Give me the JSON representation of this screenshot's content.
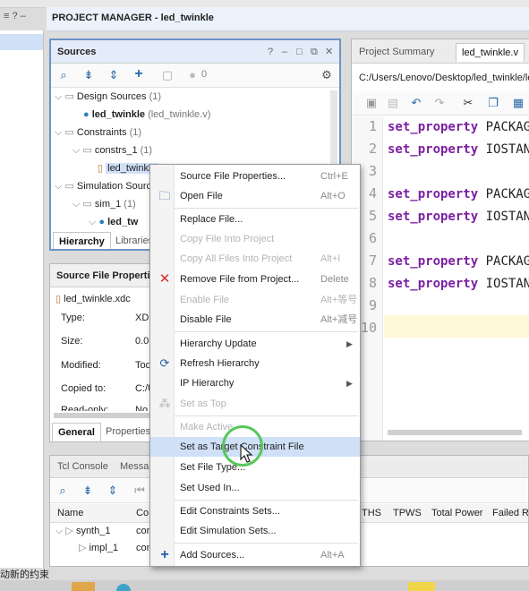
{
  "titlebar": {
    "title": "PROJECT MANAGER - led_twinkle",
    "left_glyphs": "≡ ? –"
  },
  "sources": {
    "title": "Sources",
    "controls": [
      "?",
      "–",
      "□",
      "⧉",
      "✕"
    ],
    "badge_count": "0",
    "tree": [
      {
        "text": "Design Sources",
        "count": "(1)"
      },
      {
        "text": "led_twinkle",
        "extra": "(led_twinkle.v)"
      },
      {
        "text": "Constraints",
        "count": "(1)"
      },
      {
        "text": "constrs_1",
        "count": "(1)"
      },
      {
        "text": "led_twinkle",
        "extra": ""
      },
      {
        "text": "Simulation Sources",
        "count": ""
      },
      {
        "text": "sim_1",
        "count": "(1)"
      },
      {
        "text": "led_tw",
        "extra": ""
      }
    ],
    "tabs": [
      "Hierarchy",
      "Libraries"
    ]
  },
  "properties": {
    "title": "Source File Properties",
    "file": "led_twinkle.xdc",
    "rows": [
      {
        "label": "Type:",
        "value": "XD"
      },
      {
        "label": "Size:",
        "value": "0.0"
      },
      {
        "label": "Modified:",
        "value": "Tod"
      },
      {
        "label": "Copied to:",
        "value": "C:/U"
      },
      {
        "label": "Read-only:",
        "value": "No"
      }
    ],
    "tabs": [
      "General",
      "Properties"
    ]
  },
  "bottom": {
    "tabs": [
      "Tcl Console",
      "Messa"
    ],
    "columns": [
      "Name",
      "Co",
      "THS",
      "TPWS",
      "Total Power",
      "Failed Ro"
    ],
    "rows": [
      {
        "name": "synth_1",
        "c": "con"
      },
      {
        "name": "impl_1",
        "c": "con"
      }
    ]
  },
  "editor": {
    "tabs": [
      "Project Summary",
      "led_twinkle.v"
    ],
    "path": "C:/Users/Lenovo/Desktop/led_twinkle/led_",
    "lines": [
      {
        "n": "1",
        "kw": "set_property",
        "rest": " PACKAGE"
      },
      {
        "n": "2",
        "kw": "set_property",
        "rest": " IOSTAND"
      },
      {
        "n": "3",
        "kw": "",
        "rest": ""
      },
      {
        "n": "4",
        "kw": "set_property",
        "rest": " PACKAGE"
      },
      {
        "n": "5",
        "kw": "set_property",
        "rest": " IOSTAND"
      },
      {
        "n": "6",
        "kw": "",
        "rest": ""
      },
      {
        "n": "7",
        "kw": "set_property",
        "rest": " PACKAGE"
      },
      {
        "n": "8",
        "kw": "set_property",
        "rest": " IOSTAND"
      },
      {
        "n": "9",
        "kw": "",
        "rest": ""
      },
      {
        "n": "10",
        "kw": "",
        "rest": ""
      }
    ]
  },
  "context_menu": {
    "items": [
      {
        "label": "Source File Properties...",
        "shortcut": "Ctrl+E",
        "icon": "",
        "disabled": false
      },
      {
        "label": "Open File",
        "shortcut": "Alt+O",
        "icon": "folder-icon",
        "disabled": false
      },
      {
        "label": "Replace File...",
        "shortcut": "",
        "icon": "",
        "disabled": false
      },
      {
        "label": "Copy File Into Project",
        "shortcut": "",
        "icon": "",
        "disabled": true
      },
      {
        "label": "Copy All Files Into Project",
        "shortcut": "Alt+I",
        "icon": "",
        "disabled": true
      },
      {
        "label": "Remove File from Project...",
        "shortcut": "Delete",
        "icon": "remove-x-icon",
        "disabled": false
      },
      {
        "label": "Enable File",
        "shortcut": "Alt+等号",
        "icon": "",
        "disabled": true
      },
      {
        "label": "Disable File",
        "shortcut": "Alt+减号",
        "icon": "",
        "disabled": false
      },
      {
        "label": "Hierarchy Update",
        "shortcut": "",
        "icon": "",
        "disabled": false,
        "submenu": true
      },
      {
        "label": "Refresh Hierarchy",
        "shortcut": "",
        "icon": "refresh-icon",
        "disabled": false
      },
      {
        "label": "IP Hierarchy",
        "shortcut": "",
        "icon": "",
        "disabled": false,
        "submenu": true
      },
      {
        "label": "Set as Top",
        "shortcut": "",
        "icon": "hierarchy-icon",
        "disabled": true
      },
      {
        "label": "Make Active",
        "shortcut": "",
        "icon": "",
        "disabled": true
      },
      {
        "label": "Set as Target Constraint File",
        "shortcut": "",
        "icon": "",
        "disabled": false,
        "highlighted": true
      },
      {
        "label": "Set File Type...",
        "shortcut": "",
        "icon": "",
        "disabled": false
      },
      {
        "label": "Set Used In...",
        "shortcut": "",
        "icon": "",
        "disabled": false
      },
      {
        "label": "Edit Constraints Sets...",
        "shortcut": "",
        "icon": "",
        "disabled": false
      },
      {
        "label": "Edit Simulation Sets...",
        "shortcut": "",
        "icon": "",
        "disabled": false
      },
      {
        "label": "Add Sources...",
        "shortcut": "Alt+A",
        "icon": "plus-icon",
        "disabled": false
      }
    ]
  },
  "caption_fragment": "动新的约束",
  "colors": {
    "accent": "#1a73c7",
    "menu_highlight": "#cfe0f7",
    "cursor_ring": "#58c75a"
  }
}
